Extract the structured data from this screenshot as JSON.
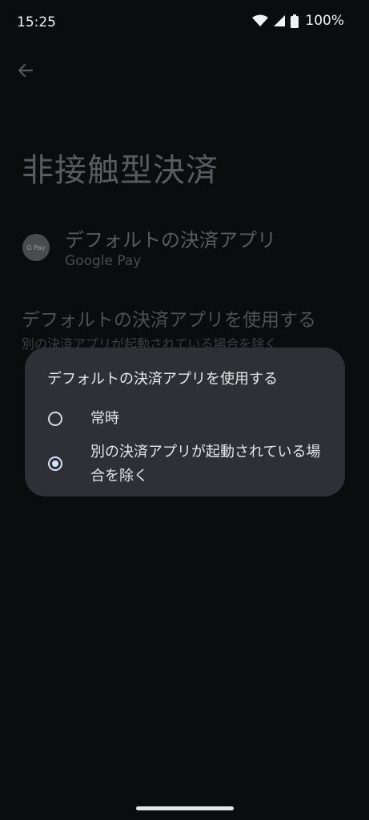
{
  "status_bar": {
    "time": "15:25",
    "battery": "100%"
  },
  "page": {
    "title": "非接触型決済",
    "default_app": {
      "title": "デフォルトの決済アプリ",
      "subtitle": "Google Pay",
      "logo_text": "G Pay"
    },
    "use_default": {
      "title": "デフォルトの決済アプリを使用する",
      "subtitle": "別の決済アプリが起動されている場合を除く"
    }
  },
  "dialog": {
    "title": "デフォルトの決済アプリを使用する",
    "options": [
      {
        "label": "常時",
        "selected": false
      },
      {
        "label": "別の決済アプリが起動されている場合を除く",
        "selected": true
      }
    ]
  },
  "colors": {
    "background": "#0b0c0e",
    "dialog": "#2e3035",
    "accent": "#d6e3ff"
  }
}
